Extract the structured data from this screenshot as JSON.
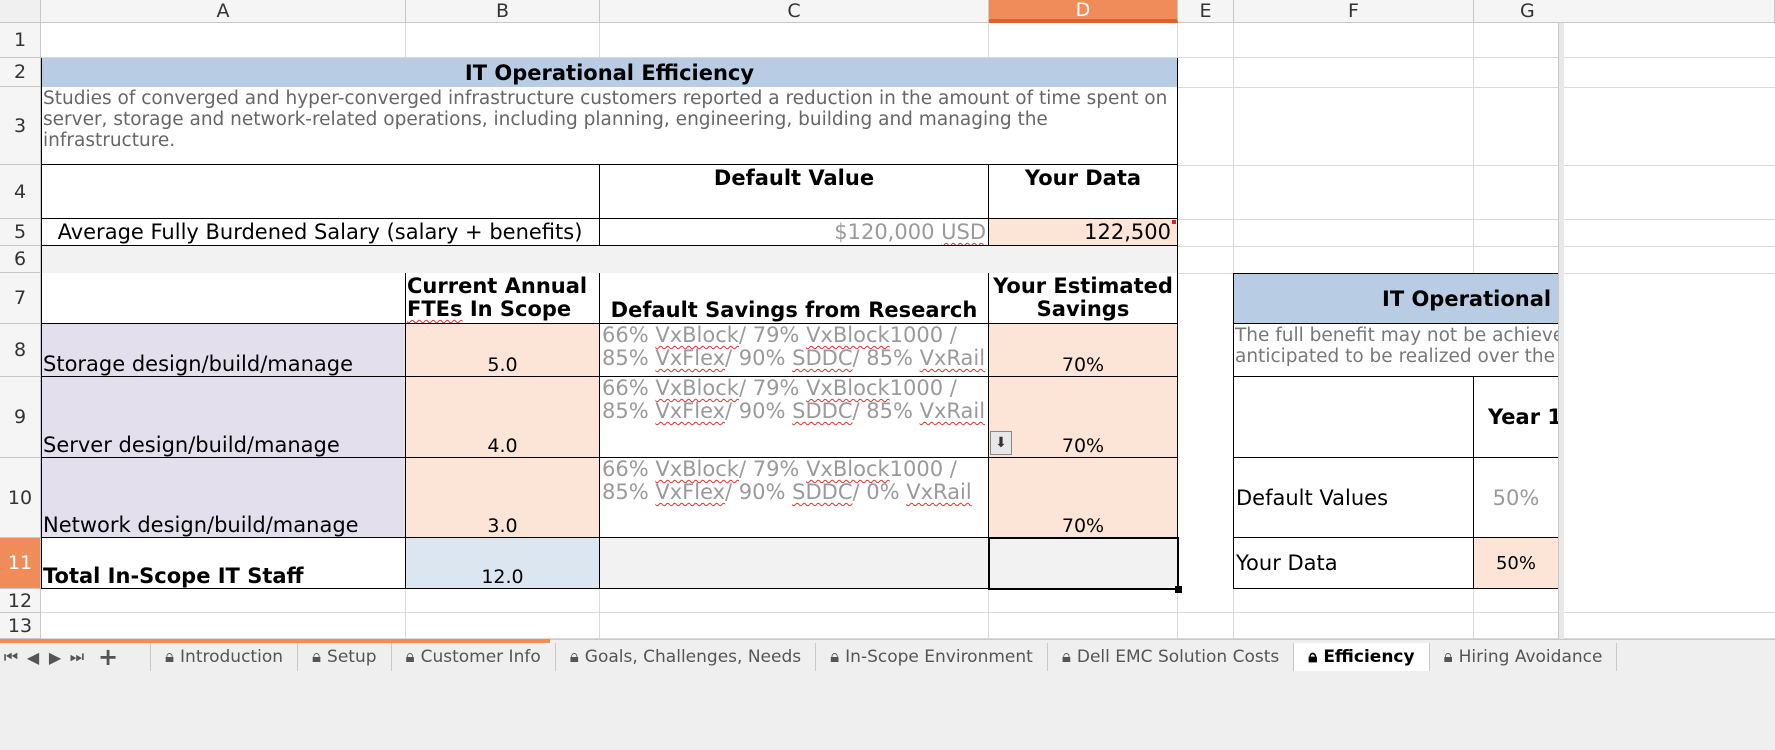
{
  "columns": [
    "A",
    "B",
    "C",
    "D",
    "E",
    "F",
    "G"
  ],
  "selected_column": "D",
  "rows": [
    "1",
    "2",
    "3",
    "4",
    "5",
    "6",
    "7",
    "8",
    "9",
    "10",
    "11",
    "12",
    "13"
  ],
  "selected_row": "11",
  "sheet": {
    "title": "IT Operational Efficiency",
    "description_lines": [
      "Studies of converged and hyper-converged infrastructure customers reported a reduction in the amount of time spent on",
      "server, storage and network-related operations, including planning, engineering, building and managing the",
      "infrastructure."
    ],
    "default_value_header": "Default Value",
    "your_data_header": "Your Data",
    "salary_label": "Average Fully Burdened Salary (salary + benefits)",
    "salary_default_amount": "$120,000",
    "salary_default_unit": "USD",
    "salary_your_data": "122,500",
    "ftes_header_line1": "Current Annual",
    "ftes_header_line2_a": "FTEs",
    "ftes_header_line2_b": " In Scope",
    "savings_research_header": "Default Savings from Research",
    "estimated_savings_header_line1": "Your Estimated",
    "estimated_savings_header_line2": "Savings",
    "research_storage_line1": "66% VxBlock/ 79% VxBlock1000 /",
    "research_storage_line2": "85% VxFlex/ 90% SDDC/ 85% VxRail",
    "research_server_line1": "66% VxBlock/ 79% VxBlock1000 /",
    "research_server_line2": "85% VxFlex/ 90% SDDC/ 85% VxRail",
    "research_network_line1": "66% VxBlock/ 79% VxBlock1000 /",
    "research_network_line2": "85% VxFlex/ 90% SDDC/ 0% VxRail",
    "storage_label": "Storage design/build/manage",
    "storage_ftes": "5.0",
    "storage_savings": "70%",
    "server_label": "Server design/build/manage",
    "server_ftes": "4.0",
    "server_savings": "70%",
    "network_label": "Network design/build/manage",
    "network_ftes": "3.0",
    "network_savings": "70%",
    "total_label": "Total In-Scope IT Staff",
    "total_ftes": "12.0",
    "right_title": "IT Operational E",
    "right_desc_line1": "The full benefit may not be achieve",
    "right_desc_line2": "anticipated to be realized over the",
    "year1_header": "Year 1",
    "default_values_label": "Default Values",
    "default_values_year1": "50%",
    "your_data_label": "Your Data",
    "your_data_year1": "50%"
  },
  "tabs": [
    {
      "label": "Introduction",
      "active": false
    },
    {
      "label": "Setup",
      "active": false
    },
    {
      "label": "Customer Info",
      "active": false
    },
    {
      "label": "Goals, Challenges, Needs",
      "active": false
    },
    {
      "label": "In-Scope Environment",
      "active": false
    },
    {
      "label": "Dell EMC Solution Costs",
      "active": false
    },
    {
      "label": "Efficiency",
      "active": true
    },
    {
      "label": "Hiring Avoidance",
      "active": false
    }
  ],
  "colors": {
    "title_fill": "#b8cce4",
    "input_fill": "#fce4d6",
    "label_fill": "#e4dfec",
    "total_fill": "#dce6f1",
    "gray_fill": "#f2f2f2",
    "selection": "#f08c5a"
  }
}
